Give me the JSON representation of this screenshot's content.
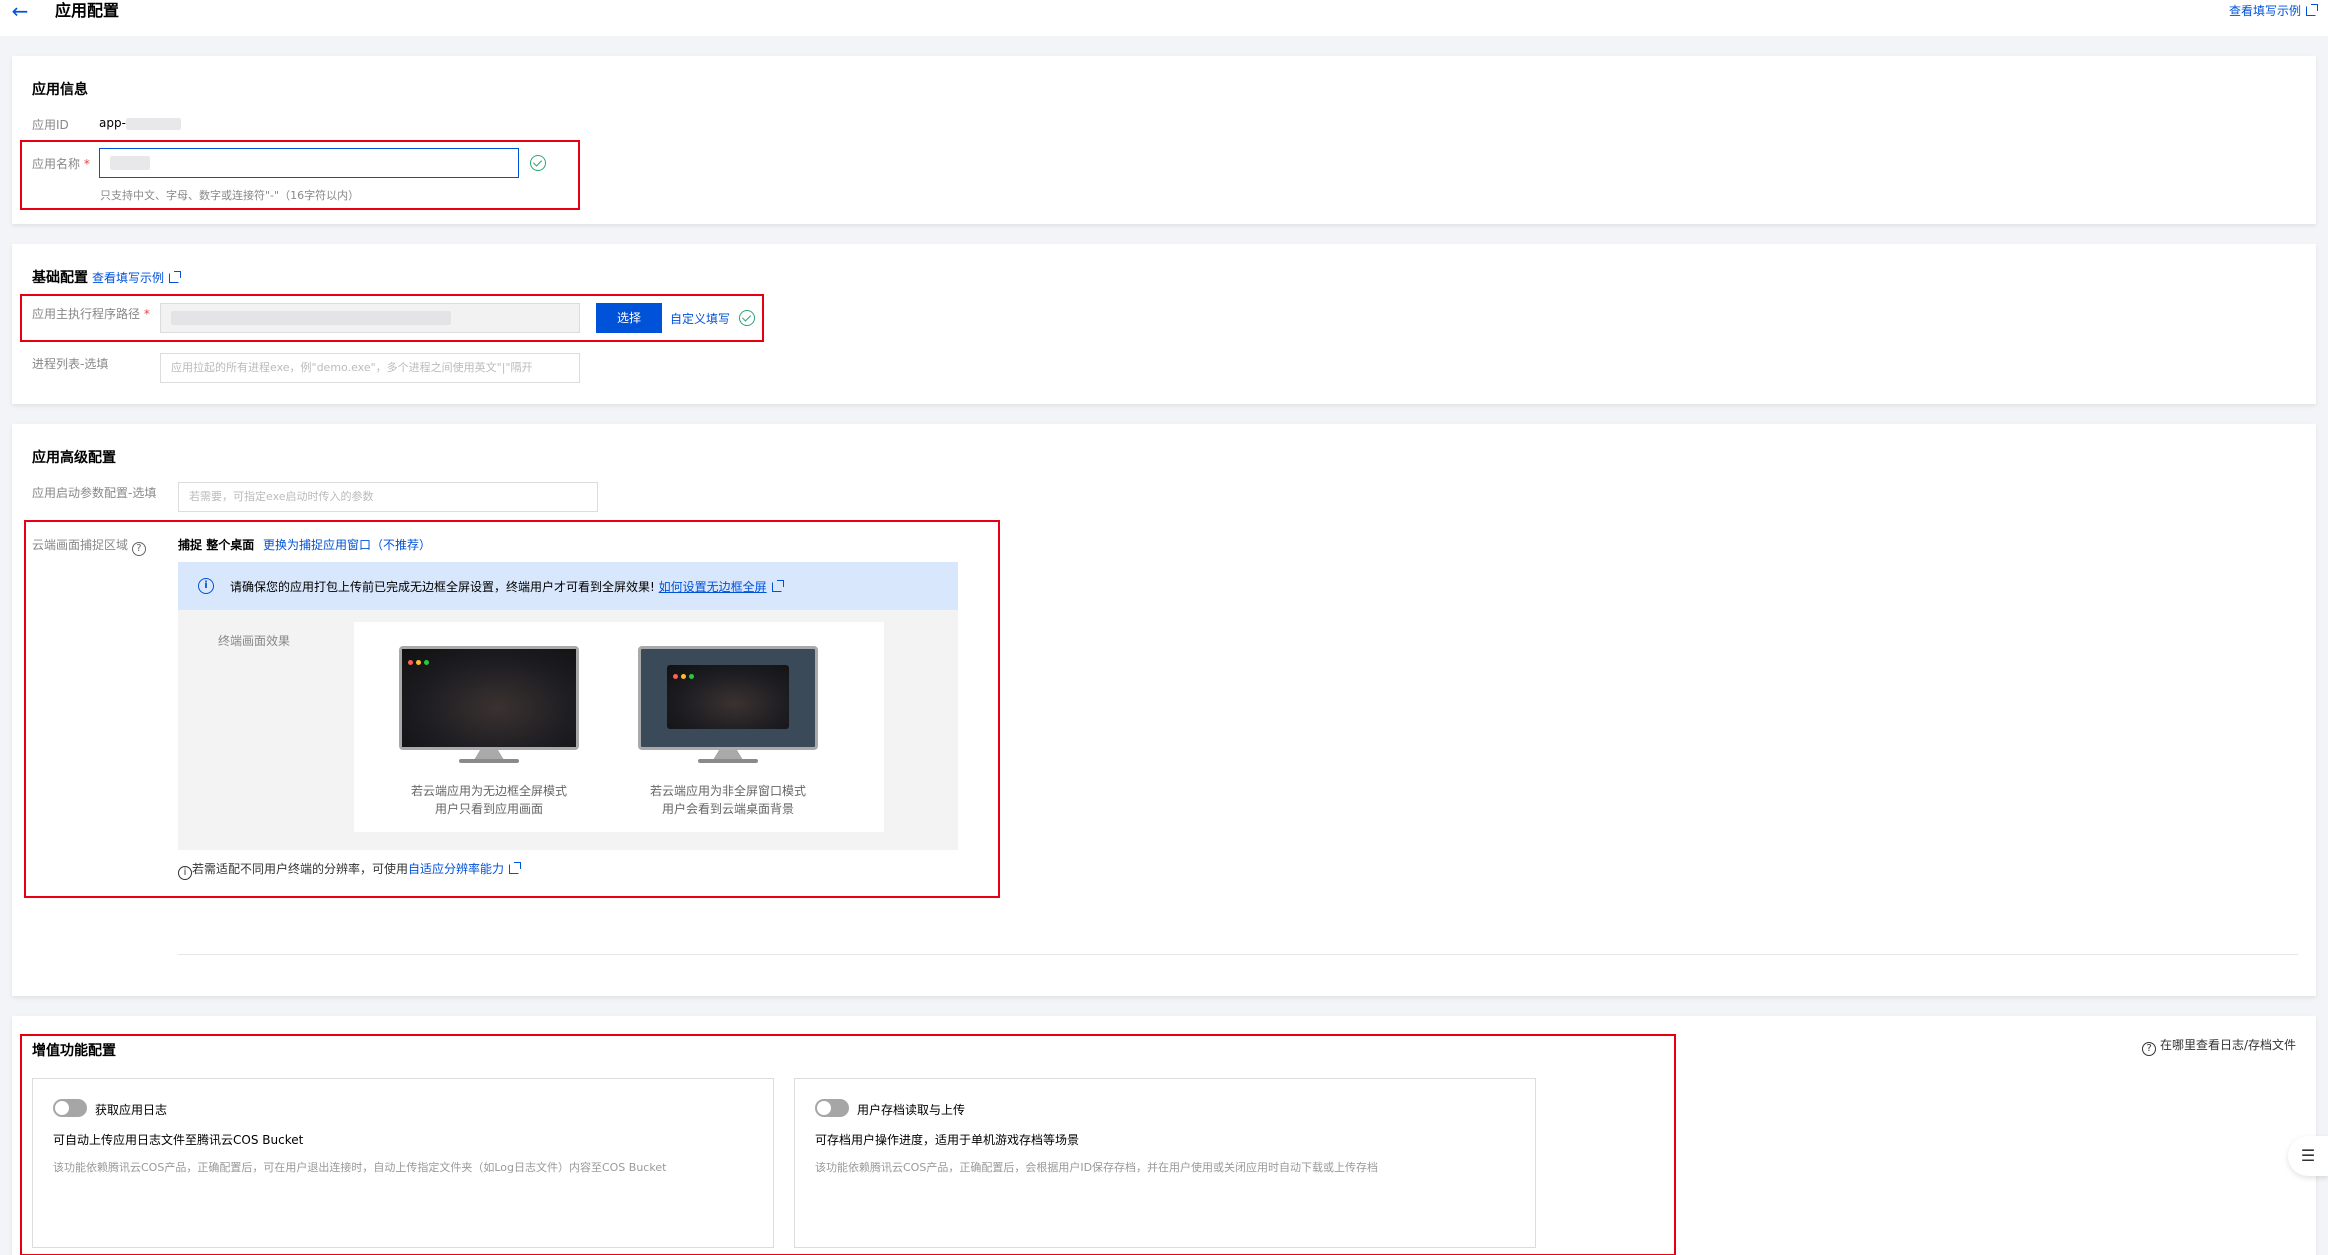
{
  "header": {
    "back_icon": "arrow-left-icon",
    "title": "应用配置",
    "example_link": "查看填写示例"
  },
  "app_info": {
    "title": "应用信息",
    "app_id_label": "应用ID",
    "app_id_value": "app-",
    "name_label": "应用名称",
    "required_mark": "*",
    "name_hint": "只支持中文、字母、数字或连接符\"-\"（16字符以内）"
  },
  "basic": {
    "title": "基础配置",
    "example_link": "查看填写示例",
    "exe_path_label": "应用主执行程序路径",
    "required_mark": "*",
    "select_button": "选择",
    "custom_link": "自定义填写",
    "process_label": "进程列表-选填",
    "process_placeholder": "应用拉起的所有进程exe，例\"demo.exe\"，多个进程之间使用英文\"|\"隔开"
  },
  "advanced": {
    "title": "应用高级配置",
    "params_label": "应用启动参数配置-选填",
    "params_placeholder": "若需要，可指定exe启动时传入的参数",
    "capture_label": "云端画面捕捉区域",
    "capture_prefix": "捕捉",
    "capture_value": "整个桌面",
    "switch_link": "更换为捕捉应用窗口（不推荐）",
    "info_text": "请确保您的应用打包上传前已完成无边框全屏设置，终端用户才可看到全屏效果!",
    "info_link": "如何设置无边框全屏",
    "preview_label": "终端画面效果",
    "caption1_line1": "若云端应用为无边框全屏模式",
    "caption1_line2": "用户只看到应用画面",
    "caption2_line1": "若云端应用为非全屏窗口模式",
    "caption2_line2": "用户会看到云端桌面背景",
    "note_text": "若需适配不同用户终端的分辨率，可使用",
    "note_link": "自适应分辨率能力"
  },
  "value_added": {
    "title": "增值功能配置",
    "where_link": "在哪里查看日志/存档文件",
    "log": {
      "toggle_label": "获取应用日志",
      "desc": "可自动上传应用日志文件至腾讯云COS Bucket",
      "detail": "该功能依赖腾讯云COS产品，正确配置后，可在用户退出连接时，自动上传指定文件夹（如Log日志文件）内容至COS Bucket"
    },
    "save": {
      "toggle_label": "用户存档读取与上传",
      "desc": "可存档用户操作进度，适用于单机游戏存档等场景",
      "detail": "该功能依赖腾讯云COS产品，正确配置后，会根据用户ID保存存档，并在用户使用或关闭应用时自动下载或上传存档"
    }
  },
  "colors": {
    "brand": "#0052d9",
    "success": "#2ba471",
    "highlight": "#e60012"
  }
}
